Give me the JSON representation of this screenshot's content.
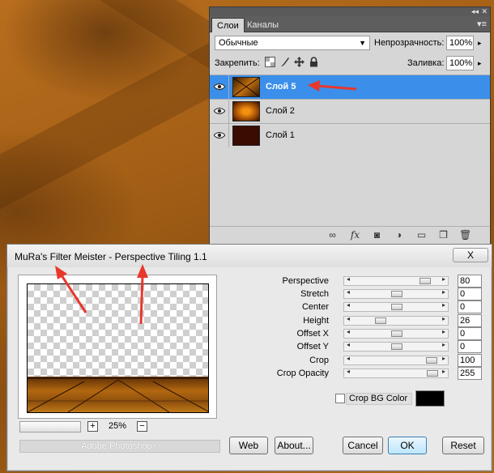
{
  "layers_panel": {
    "tabs": [
      "Слои",
      "Каналы"
    ],
    "blend_mode": "Обычные",
    "opacity_label": "Непрозрачность:",
    "opacity_value": "100%",
    "lock_label": "Закрепить:",
    "fill_label": "Заливка:",
    "fill_value": "100%",
    "layers": [
      {
        "name": "Слой 5",
        "selected": true,
        "visible": true
      },
      {
        "name": "Слой 2",
        "selected": false,
        "visible": true
      },
      {
        "name": "Слой 1",
        "selected": false,
        "visible": true
      }
    ],
    "bottom_icons": [
      "link-icon",
      "fx-icon",
      "mask-icon",
      "adjustment-icon",
      "group-icon",
      "new-layer-icon",
      "trash-icon"
    ]
  },
  "dialog": {
    "title": "MuRa's Filter Meister - Perspective Tiling 1.1",
    "close_label": "X",
    "zoom_level": "25%",
    "zoom_plus": "+",
    "zoom_minus": "−",
    "host_label": "Adobe Photoshop®",
    "params": [
      {
        "label": "Perspective",
        "value": "80",
        "fraction": 0.72
      },
      {
        "label": "Stretch",
        "value": "0",
        "fraction": 0.5
      },
      {
        "label": "Center",
        "value": "0",
        "fraction": 0.5
      },
      {
        "label": "Height",
        "value": "26",
        "fraction": 0.33
      },
      {
        "label": "Offset X",
        "value": "0",
        "fraction": 0.5
      },
      {
        "label": "Offset Y",
        "value": "0",
        "fraction": 0.5
      },
      {
        "label": "Crop",
        "value": "100",
        "fraction": 0.8
      },
      {
        "label": "Crop Opacity",
        "value": "255",
        "fraction": 0.82
      }
    ],
    "crop_bg_label": "Crop BG Color",
    "crop_bg_checked": false,
    "crop_bg_color": "#000000",
    "buttons": {
      "web": "Web",
      "about": "About...",
      "cancel": "Cancel",
      "ok": "OK",
      "reset": "Reset"
    }
  },
  "colors": {
    "selection": "#3b8fea",
    "annotation_arrow": "#e8382c"
  }
}
